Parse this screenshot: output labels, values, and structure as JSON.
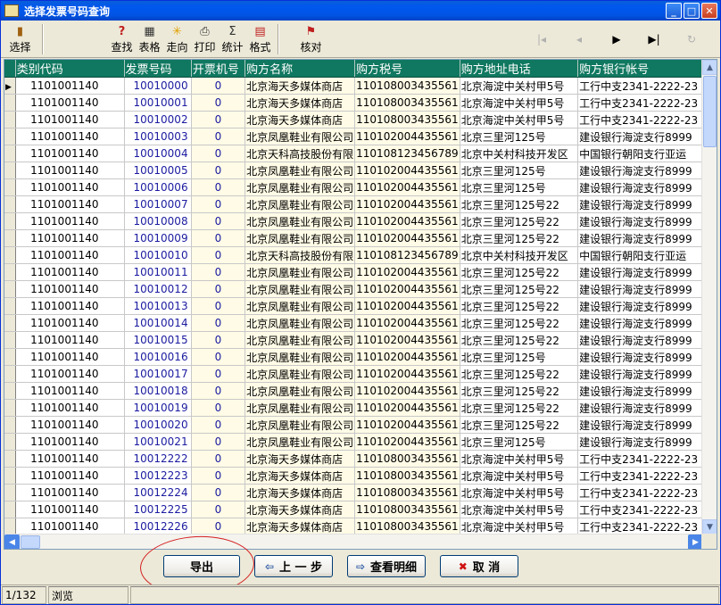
{
  "window": {
    "title": "选择发票号码查询"
  },
  "toolbar": {
    "select": "选择",
    "find": "查找",
    "table": "表格",
    "direction": "走向",
    "print": "打印",
    "stats": "统计",
    "format": "格式",
    "check": "核对"
  },
  "grid": {
    "columns": [
      "类别代码",
      "发票号码",
      "开票机号",
      "购方名称",
      "购方税号",
      "购方地址电话",
      "购方银行帐号"
    ],
    "rows": [
      [
        "1101001140",
        "10010000",
        "0",
        "北京海天多媒体商店",
        "110108003435561",
        "北京海淀中关村甲5号",
        "工行中支2341-2222-23"
      ],
      [
        "1101001140",
        "10010001",
        "0",
        "北京海天多媒体商店",
        "110108003435561",
        "北京海淀中关村甲5号",
        "工行中支2341-2222-23"
      ],
      [
        "1101001140",
        "10010002",
        "0",
        "北京海天多媒体商店",
        "110108003435561",
        "北京海淀中关村甲5号",
        "工行中支2341-2222-23"
      ],
      [
        "1101001140",
        "10010003",
        "0",
        "北京凤凰鞋业有限公司",
        "110102004435561",
        "北京三里河125号",
        "建设银行海淀支行8999"
      ],
      [
        "1101001140",
        "10010004",
        "0",
        "北京天科高技股份有限",
        "110108123456789",
        "北京中关村科技开发区",
        "中国银行朝阳支行亚运"
      ],
      [
        "1101001140",
        "10010005",
        "0",
        "北京凤凰鞋业有限公司",
        "110102004435561",
        "北京三里河125号",
        "建设银行海淀支行8999"
      ],
      [
        "1101001140",
        "10010006",
        "0",
        "北京凤凰鞋业有限公司",
        "110102004435561",
        "北京三里河125号",
        "建设银行海淀支行8999"
      ],
      [
        "1101001140",
        "10010007",
        "0",
        "北京凤凰鞋业有限公司",
        "110102004435561",
        "北京三里河125号22",
        "建设银行海淀支行8999"
      ],
      [
        "1101001140",
        "10010008",
        "0",
        "北京凤凰鞋业有限公司",
        "110102004435561",
        "北京三里河125号22",
        "建设银行海淀支行8999"
      ],
      [
        "1101001140",
        "10010009",
        "0",
        "北京凤凰鞋业有限公司",
        "110102004435561",
        "北京三里河125号22",
        "建设银行海淀支行8999"
      ],
      [
        "1101001140",
        "10010010",
        "0",
        "北京天科高技股份有限",
        "110108123456789",
        "北京中关村科技开发区",
        "中国银行朝阳支行亚运"
      ],
      [
        "1101001140",
        "10010011",
        "0",
        "北京凤凰鞋业有限公司",
        "110102004435561",
        "北京三里河125号22",
        "建设银行海淀支行8999"
      ],
      [
        "1101001140",
        "10010012",
        "0",
        "北京凤凰鞋业有限公司",
        "110102004435561",
        "北京三里河125号22",
        "建设银行海淀支行8999"
      ],
      [
        "1101001140",
        "10010013",
        "0",
        "北京凤凰鞋业有限公司",
        "110102004435561",
        "北京三里河125号22",
        "建设银行海淀支行8999"
      ],
      [
        "1101001140",
        "10010014",
        "0",
        "北京凤凰鞋业有限公司",
        "110102004435561",
        "北京三里河125号22",
        "建设银行海淀支行8999"
      ],
      [
        "1101001140",
        "10010015",
        "0",
        "北京凤凰鞋业有限公司",
        "110102004435561",
        "北京三里河125号22",
        "建设银行海淀支行8999"
      ],
      [
        "1101001140",
        "10010016",
        "0",
        "北京凤凰鞋业有限公司",
        "110102004435561",
        "北京三里河125号",
        "建设银行海淀支行8999"
      ],
      [
        "1101001140",
        "10010017",
        "0",
        "北京凤凰鞋业有限公司",
        "110102004435561",
        "北京三里河125号22",
        "建设银行海淀支行8999"
      ],
      [
        "1101001140",
        "10010018",
        "0",
        "北京凤凰鞋业有限公司",
        "110102004435561",
        "北京三里河125号22",
        "建设银行海淀支行8999"
      ],
      [
        "1101001140",
        "10010019",
        "0",
        "北京凤凰鞋业有限公司",
        "110102004435561",
        "北京三里河125号22",
        "建设银行海淀支行8999"
      ],
      [
        "1101001140",
        "10010020",
        "0",
        "北京凤凰鞋业有限公司",
        "110102004435561",
        "北京三里河125号22",
        "建设银行海淀支行8999"
      ],
      [
        "1101001140",
        "10010021",
        "0",
        "北京凤凰鞋业有限公司",
        "110102004435561",
        "北京三里河125号",
        "建设银行海淀支行8999"
      ],
      [
        "1101001140",
        "10012222",
        "0",
        "北京海天多媒体商店",
        "110108003435561",
        "北京海淀中关村甲5号",
        "工行中支2341-2222-23"
      ],
      [
        "1101001140",
        "10012223",
        "0",
        "北京海天多媒体商店",
        "110108003435561",
        "北京海淀中关村甲5号",
        "工行中支2341-2222-23"
      ],
      [
        "1101001140",
        "10012224",
        "0",
        "北京海天多媒体商店",
        "110108003435561",
        "北京海淀中关村甲5号",
        "工行中支2341-2222-23"
      ],
      [
        "1101001140",
        "10012225",
        "0",
        "北京海天多媒体商店",
        "110108003435561",
        "北京海淀中关村甲5号",
        "工行中支2341-2222-23"
      ],
      [
        "1101001140",
        "10012226",
        "0",
        "北京海天多媒体商店",
        "110108003435561",
        "北京海淀中关村甲5号",
        "工行中支2341-2222-23"
      ]
    ]
  },
  "buttons": {
    "export": "导出",
    "prev": "上 一 步",
    "detail": "查看明细",
    "cancel": "取  消"
  },
  "status": {
    "position": "1/132",
    "mode": "浏览"
  }
}
